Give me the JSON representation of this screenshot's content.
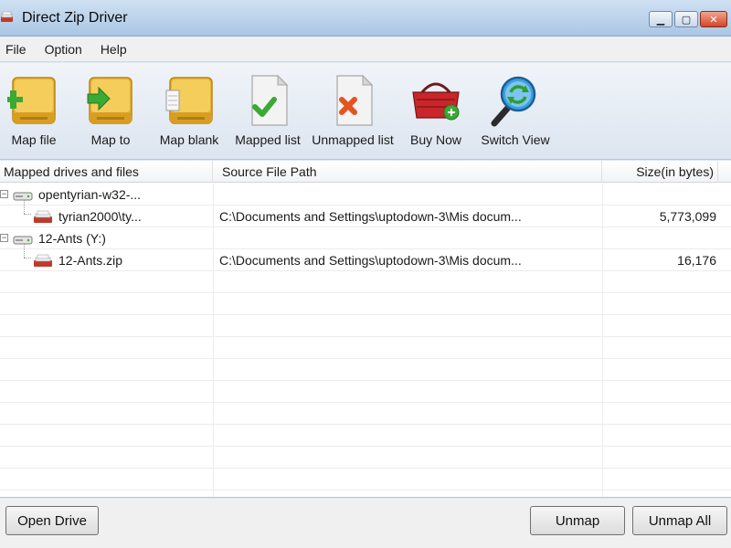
{
  "window": {
    "title": "Direct Zip Driver",
    "minimize_icon": "minimize-icon",
    "maximize_icon": "maximize-icon",
    "close_icon": "close-icon"
  },
  "menu": {
    "items": [
      {
        "label": "File"
      },
      {
        "label": "Option"
      },
      {
        "label": "Help"
      }
    ]
  },
  "toolbar": {
    "buttons": [
      {
        "label": "Map file",
        "icon": "drive-add-icon"
      },
      {
        "label": "Map to",
        "icon": "drive-arrow-icon"
      },
      {
        "label": "Map blank",
        "icon": "drive-blank-icon"
      },
      {
        "label": "Mapped list",
        "icon": "document-check-icon"
      },
      {
        "label": "Unmapped list",
        "icon": "document-cross-icon"
      },
      {
        "label": "Buy Now",
        "icon": "shopping-basket-icon"
      },
      {
        "label": "Switch View",
        "icon": "magnifier-refresh-icon"
      }
    ]
  },
  "list": {
    "columns": [
      {
        "label": "Mapped drives and files"
      },
      {
        "label": "Source File Path"
      },
      {
        "label": "Size(in bytes)"
      }
    ],
    "rows": [
      {
        "name": "opentyrian-w32-...",
        "path": "",
        "size": "",
        "level": 0,
        "expand": "−"
      },
      {
        "name": "tyrian2000\\ty...",
        "path": "C:\\Documents and Settings\\uptodown-3\\Mis docum...",
        "size": "5,773,099",
        "level": 1
      },
      {
        "name": "12-Ants (Y:)",
        "path": "",
        "size": "",
        "level": 0,
        "expand": "−"
      },
      {
        "name": "12-Ants.zip",
        "path": "C:\\Documents and Settings\\uptodown-3\\Mis docum...",
        "size": "16,176",
        "level": 1
      }
    ]
  },
  "footer": {
    "open_drive": "Open Drive",
    "unmap": "Unmap",
    "unmap_all": "Unmap All"
  }
}
